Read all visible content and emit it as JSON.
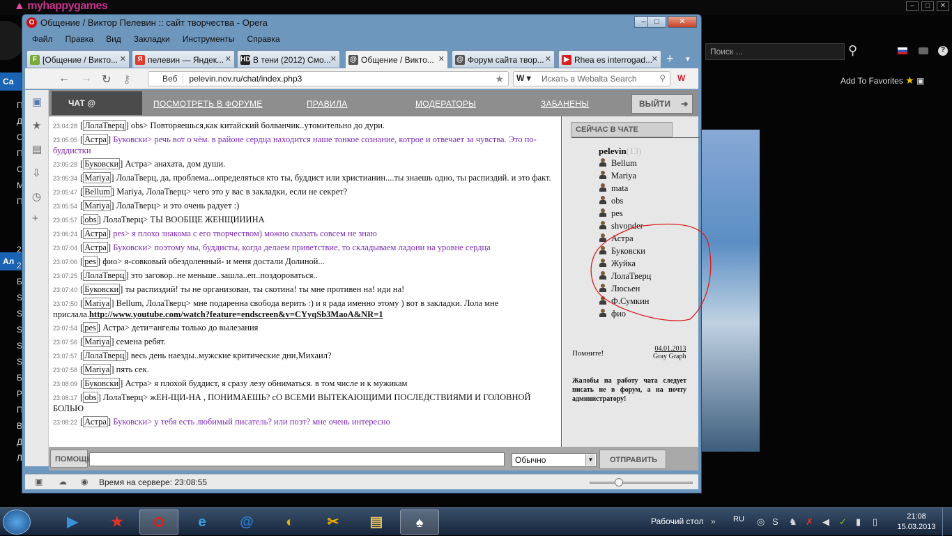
{
  "background_app": {
    "logo": "myhappygames",
    "search_placeholder": "Поиск ...",
    "add_favorites": "Add To Favorites",
    "left_labels": [
      "Са",
      "П",
      "Д",
      "С",
      "П",
      "С",
      "М",
      "П",
      "Ал",
      "2",
      "2",
      "Б",
      "S",
      "S",
      "S",
      "S",
      "S",
      "Б",
      "Р",
      "П",
      "В",
      "Д",
      "Л"
    ]
  },
  "opera": {
    "title": "Общение / Виктор Пелевин :: сайт творчества - Opera",
    "menu": [
      "Файл",
      "Правка",
      "Вид",
      "Закладки",
      "Инструменты",
      "Справка"
    ],
    "tabs": [
      {
        "label": "[Общение / Викто...",
        "icon": "F",
        "color": "#7aa83a"
      },
      {
        "label": "пелевин — Яндек...",
        "icon": "Я",
        "color": "#e03a2e"
      },
      {
        "label": "В тени (2012) Смо...",
        "icon": "HD",
        "color": "#222222"
      },
      {
        "label": "Общение / Викто...",
        "icon": "@",
        "color": "#555555"
      },
      {
        "label": "Форум сайта твор...",
        "icon": "@",
        "color": "#555555"
      },
      {
        "label": "Rhea es interrogad...",
        "icon": "▶",
        "color": "#d62020"
      }
    ],
    "url_label": "Веб",
    "url": "pelevin.nov.ru/chat/index.php3",
    "search_placeholder": "Искать в Webalta Search",
    "status_text": "Время на сервере: 23:08:55"
  },
  "chat": {
    "logo": "ЧАТ",
    "nav": [
      "ПОСМОТРЕТЬ В ФОРУМЕ",
      "ПРАВИЛА",
      "МОДЕРАТОРЫ",
      "ЗАБАНЕНЫ"
    ],
    "exit": "ВЫЙТИ",
    "messages": [
      {
        "time": "23:04:28",
        "nick": "ЛолаТверц",
        "text": "obs> Повторяешься,как китайский болванчик..утомительно до дури.",
        "purple": false
      },
      {
        "time": "23:05:05",
        "nick": "Астра",
        "text": "Буковски> речь вот о чём. в районе сердца находится наше тонкое сознание, котрое и отвечает за чувства. Это по-буддистки",
        "purple": true
      },
      {
        "time": "23:05:28",
        "nick": "Буковски",
        "text": "Астра> анахата, дом души.",
        "purple": false
      },
      {
        "time": "23:05:34",
        "nick": "Mariya",
        "text": "ЛолаТверц, да, проблема...определяться кто ты, буддист или христианин....ты знаешь одно, ты распиздий. и это факт.",
        "purple": false
      },
      {
        "time": "23:05:47",
        "nick": "Bellum",
        "text": "Mariya, ЛолаТверц> чего это у вас в закладки, если не секрет?",
        "purple": false
      },
      {
        "time": "23:05:54",
        "nick": "Mariya",
        "text": "ЛолаТверц> и это очень радует :)",
        "purple": false
      },
      {
        "time": "23:05:57",
        "nick": "obs",
        "text": "ЛолаТверц> ТЫ ВООБЩЕ ЖЕНЩИИИНА",
        "purple": false
      },
      {
        "time": "23:06:24",
        "nick": "Астра",
        "text": "pes> я плохо знакома с его творчеством) можно сказать совсем не знаю",
        "purple": true
      },
      {
        "time": "23:07:04",
        "nick": "Астра",
        "text": "Буковски> поэтому мы, буддисты, когда делаем приветствие, то складываем ладони на уровне сердца",
        "purple": true
      },
      {
        "time": "23:07:06",
        "nick": "pes",
        "text": "фио> я-совковый обездоленный- и меня достали Долиной...",
        "purple": false
      },
      {
        "time": "23:07:25",
        "nick": "ЛолаТверц",
        "text": "это заговор..не меньше..зашла..еп..поздороваться..",
        "purple": false
      },
      {
        "time": "23:07:40",
        "nick": "Буковски",
        "text": "ты распиздий! ты не организован, ты скотина! ты мне противен на! иди на!",
        "purple": false
      },
      {
        "time": "23:07:50",
        "nick": "Mariya",
        "text": "Bellum, ЛолаТверц> мне подаренна свобода верить :) и я рада именно этому ) вот в закладки. Лола мне прислала.",
        "link": "http://www.youtube.com/watch?feature=endscreen&v=CYyqSb3MaoA&NR=1",
        "purple": false
      },
      {
        "time": "23:07:54",
        "nick": "pes",
        "text": "Астра> дети=ангелы только до вылезания",
        "purple": false
      },
      {
        "time": "23:07:56",
        "nick": "Mariya",
        "text": "семена ребят.",
        "purple": false
      },
      {
        "time": "23:07:57",
        "nick": "ЛолаТверц",
        "text": "весь день наезды..мужские критические дни,Михаил?",
        "purple": false
      },
      {
        "time": "23:07:58",
        "nick": "Mariya",
        "text": "пять сек.",
        "purple": false
      },
      {
        "time": "23:08:09",
        "nick": "Буковски",
        "text": "Астра> я плохой буддист, я сразу лезу обниматься. в том числе и к мужикам",
        "purple": false
      },
      {
        "time": "23:08:17",
        "nick": "obs",
        "text": "ЛолаТверц> жЕН-ЩИ-НА , ПОНИМАЕШЬ? сО ВСЕМИ ВЫТЕКАЮЩИМИ ПОСЛЕДСТВИЯМИ И ГОЛОВНОЙ БОЛЬЮ",
        "purple": false
      },
      {
        "time": "23:08:22",
        "nick": "Астра",
        "text": "Буковски> у тебя есть любимый писатель? или поэт? мне очень интересно",
        "purple": true
      }
    ],
    "online_title": "СЕЙЧАС В ЧАТЕ",
    "owner": "pelevin",
    "owner_count": "(13)",
    "users": [
      "Bellum",
      "Mariya",
      "mata",
      "obs",
      "pes",
      "shvonder",
      "Астра",
      "Буковски",
      "Жуйка",
      "ЛолаТверц",
      "Люсьен",
      "Ф.Сумкин",
      "фио"
    ],
    "remember": "Помните!",
    "remember_date": "04.01.2013",
    "remember_author": "Gray Graph",
    "complaint": "Жалобы на работу чата следует писать не в форум, а на почту администратору!",
    "help": "ПОМОЩЬ",
    "style_option": "Обычно",
    "send": "ОТПРАВИТЬ"
  },
  "taskbar": {
    "desktop_label": "Рабочий стол",
    "lang": "RU",
    "time": "21:08",
    "date": "15.03.2013"
  }
}
